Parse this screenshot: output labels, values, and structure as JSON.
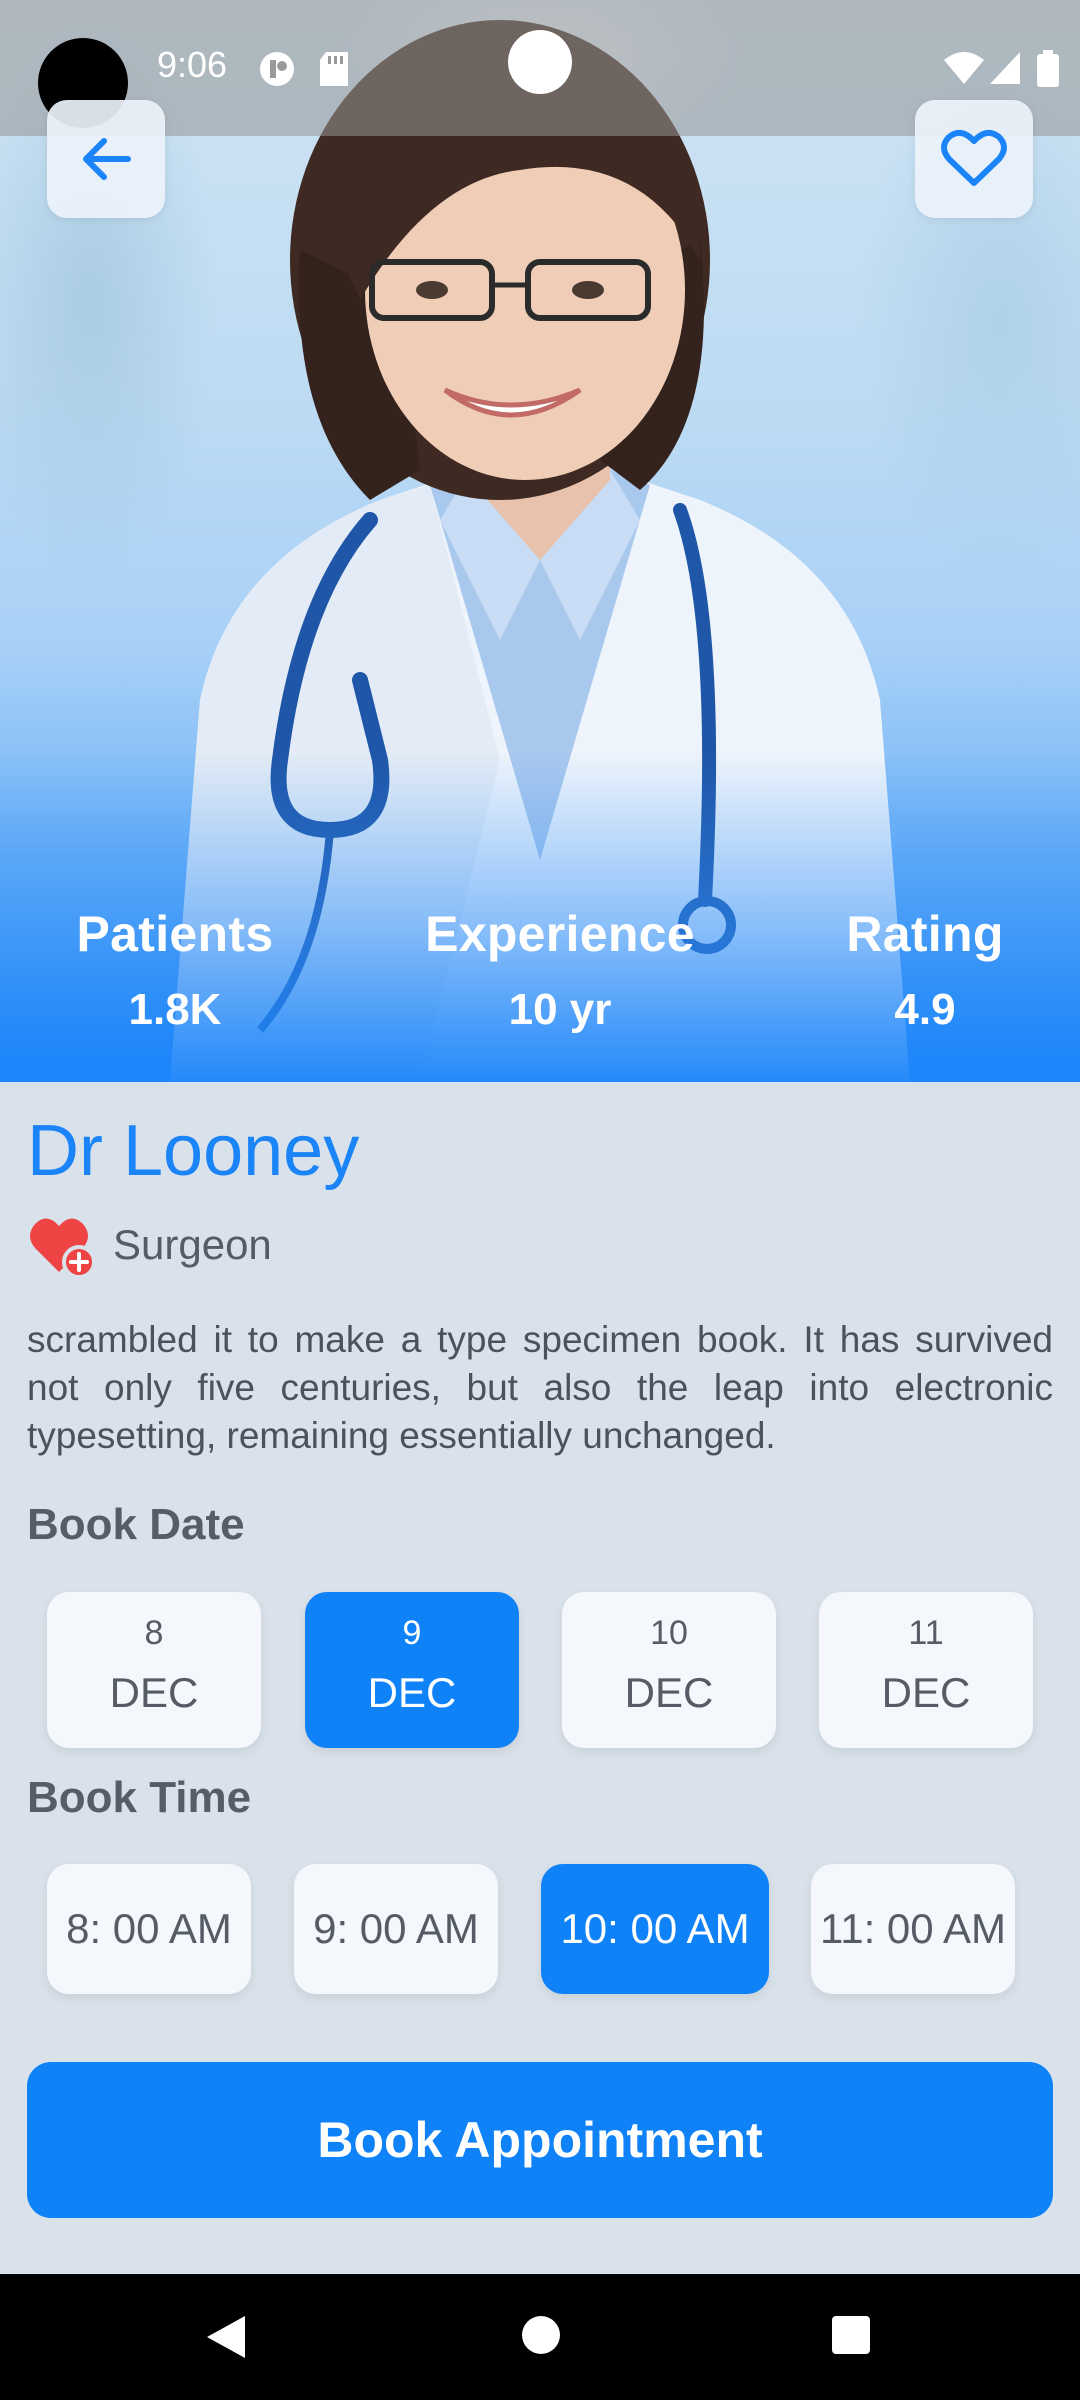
{
  "status_bar": {
    "time": "9:06",
    "icons": [
      "camera-hole",
      "notification-app-icon",
      "sd-card-icon",
      "wifi-icon",
      "signal-icon",
      "battery-icon"
    ]
  },
  "header": {
    "back_icon": "arrow-left-icon",
    "favorite_icon": "heart-outline-icon"
  },
  "stats": [
    {
      "label": "Patients",
      "value": "1.8K"
    },
    {
      "label": "Experience",
      "value": "10 yr"
    },
    {
      "label": "Rating",
      "value": "4.9"
    }
  ],
  "doctor": {
    "name": "Dr Looney",
    "specialty": "Surgeon",
    "specialty_icon": "heart-plus-icon",
    "description": "scrambled it to make a type specimen book. It has survived not only five centuries, but also the leap into electronic typesetting, remaining essentially unchanged."
  },
  "booking": {
    "date_title": "Book Date",
    "dates": [
      {
        "day": "8",
        "month": "DEC",
        "selected": false
      },
      {
        "day": "9",
        "month": "DEC",
        "selected": true
      },
      {
        "day": "10",
        "month": "DEC",
        "selected": false
      },
      {
        "day": "11",
        "month": "DEC",
        "selected": false
      }
    ],
    "time_title": "Book Time",
    "times": [
      {
        "label": "8: 00 AM",
        "selected": false
      },
      {
        "label": "9: 00 AM",
        "selected": false
      },
      {
        "label": "10: 00 AM",
        "selected": true
      },
      {
        "label": "11: 00 AM",
        "selected": false
      }
    ],
    "button_label": "Book Appointment"
  },
  "colors": {
    "accent": "#0f82f8",
    "name": "#1a84f8",
    "background": "#d9e1ea",
    "card": "#f4f7fc",
    "heart_icon": "#ef4444"
  }
}
